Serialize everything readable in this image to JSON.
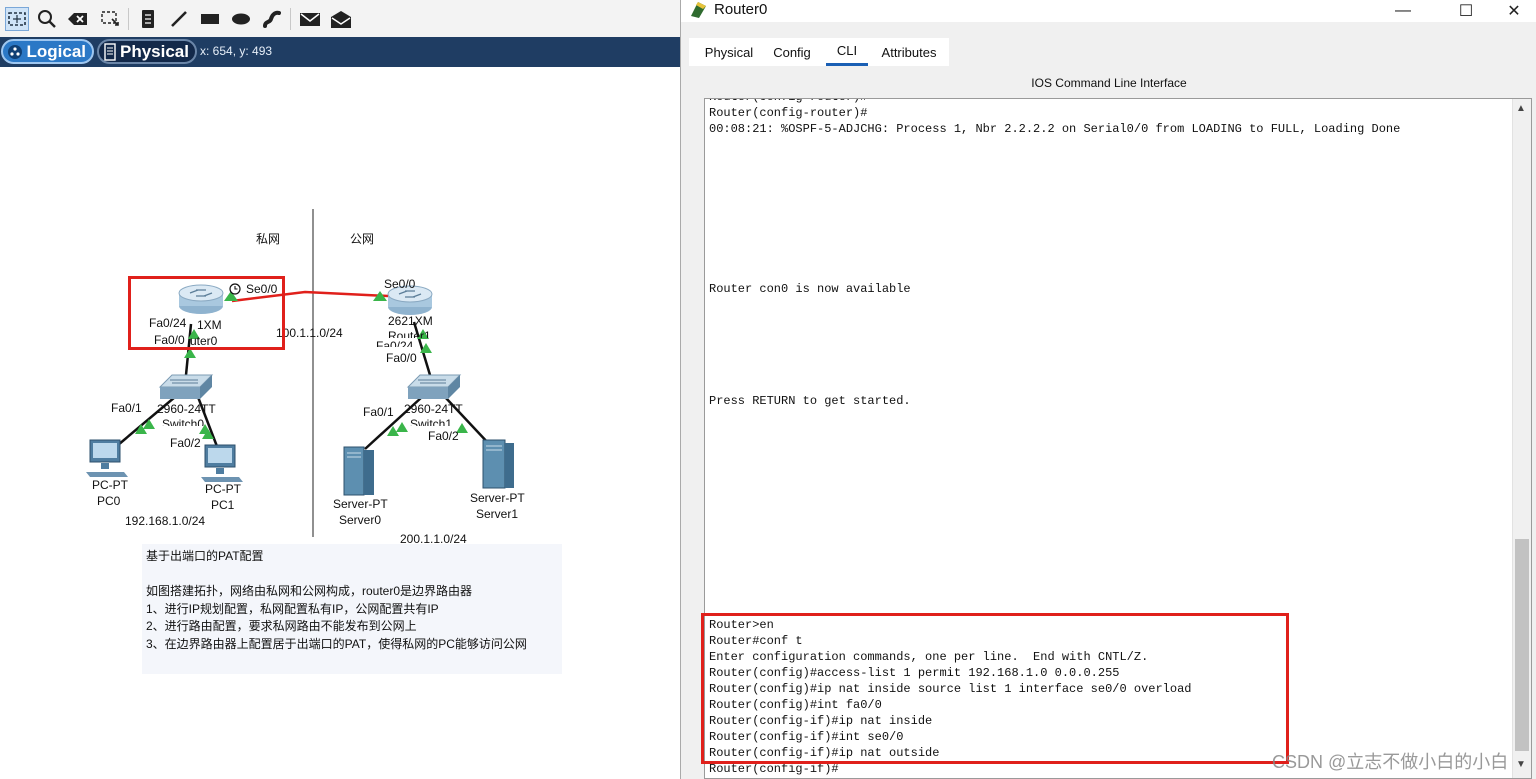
{
  "toolbar": {
    "tools": [
      "select-icon",
      "inspect-icon",
      "delete-icon",
      "resize-icon",
      "note-icon",
      "line-icon",
      "rectangle-icon",
      "ellipse-icon",
      "freeform-icon",
      "simple-pdu-icon",
      "complex-pdu-icon"
    ]
  },
  "modes": {
    "logical": "Logical",
    "physical": "Physical",
    "coords": "x: 654, y: 493"
  },
  "topology": {
    "private_label": "私网",
    "public_label": "公网",
    "router0": {
      "port_se": "Se0/0",
      "port_fa24": "Fa0/24",
      "model": "1XM",
      "port_fa0": "Fa0/0",
      "name": "uter0"
    },
    "router1": {
      "port_se": "Se0/0",
      "model": "2621XM",
      "name": "Router1",
      "port_fa24": "Fa0/24",
      "port_fa0": "Fa0/0"
    },
    "wan_net": "100.1.1.0/24",
    "switch0": {
      "model": "2960-24TT",
      "name": "Switch0",
      "port_fa1": "Fa0/1",
      "port_fa2": "Fa0/2"
    },
    "switch1": {
      "model": "2960-24TT",
      "name": "Switch1",
      "port_fa1": "Fa0/1",
      "port_fa2": "Fa0/2"
    },
    "pc0": {
      "type": "PC-PT",
      "name": "PC0"
    },
    "pc1": {
      "type": "PC-PT",
      "name": "PC1"
    },
    "server0": {
      "type": "Server-PT",
      "name": "Server0"
    },
    "server1": {
      "type": "Server-PT",
      "name": "Server1"
    },
    "lan0_net": "192.168.1.0/24",
    "lan1_net": "200.1.1.0/24"
  },
  "note": {
    "title": "基于出端口的PAT配置",
    "lines": [
      "如图搭建拓扑，网络由私网和公网构成，router0是边界路由器",
      "1、进行IP规划配置，私网配置私有IP，公网配置共有IP",
      "2、进行路由配置，要求私网路由不能发布到公网上",
      "3、在边界路由器上配置居于出端口的PAT，使得私网的PC能够访问公网"
    ]
  },
  "window": {
    "title": "Router0",
    "controls": {
      "minimize": "—",
      "maximize": "☐",
      "close": "✕"
    },
    "tabs": [
      "Physical",
      "Config",
      "CLI",
      "Attributes"
    ],
    "active_tab": "CLI",
    "cli_header": "IOS Command Line Interface"
  },
  "cli": {
    "top_lines": [
      "Router(config-router)#",
      "00:08:21: %OSPF-5-ADJCHG: Process 1, Nbr 2.2.2.2 on Serial0/0 from LOADING to FULL, Loading Done"
    ],
    "con0_line": "Router con0 is now available",
    "press_line": "Press RETURN to get started.",
    "config_lines": [
      "Router>en",
      "Router#conf t",
      "Enter configuration commands, one per line.  End with CNTL/Z.",
      "Router(config)#access-list 1 permit 192.168.1.0 0.0.0.255",
      "Router(config)#ip nat inside source list 1 interface se0/0 overload",
      "Router(config)#int fa0/0",
      "Router(config-if)#ip nat inside",
      "Router(config-if)#int se0/0",
      "Router(config-if)#ip nat outside",
      "Router(config-if)#"
    ]
  },
  "watermark": "CSDN @立志不做小白的小白",
  "colors": {
    "highlight": "#e0201b",
    "link_up": "#3ab54a",
    "serial_link": "#e0201b",
    "mode_bar": "#1f3d63"
  }
}
